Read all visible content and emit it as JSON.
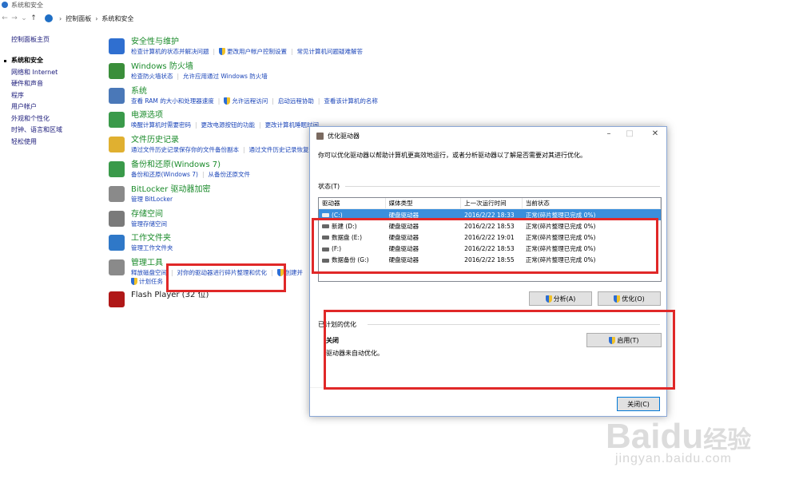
{
  "window": {
    "title": "系统和安全"
  },
  "address": {
    "crumbs": [
      "控制面板",
      "系统和安全"
    ]
  },
  "sidebar": {
    "home": "控制面板主页",
    "items": [
      "系统和安全",
      "网络和 Internet",
      "硬件和声音",
      "程序",
      "用户帐户",
      "外观和个性化",
      "时钟、语言和区域",
      "轻松使用"
    ]
  },
  "categories": [
    {
      "title": "安全性与维护",
      "links": [
        "检查计算机的状态并解决问题",
        "更改用户帐户控制设置",
        "常见计算机问题疑难解答"
      ],
      "icon": "flag-icon",
      "color": "#2f6fd0"
    },
    {
      "title": "Windows 防火墙",
      "links": [
        "检查防火墙状态",
        "允许应用通过 Windows 防火墙"
      ],
      "icon": "firewall-icon",
      "color": "#3a8e3a"
    },
    {
      "title": "系统",
      "links": [
        "查看 RAM 的大小和处理器速度",
        "允许远程访问",
        "启动远程协助",
        "查看该计算机的名称"
      ],
      "icon": "computer-icon",
      "color": "#4a78b8"
    },
    {
      "title": "电源选项",
      "links": [
        "唤醒计算机时需要密码",
        "更改电源按钮的功能",
        "更改计算机睡眠时间"
      ],
      "icon": "power-icon",
      "color": "#3a9a4a"
    },
    {
      "title": "文件历史记录",
      "links": [
        "通过文件历史记录保存你的文件备份副本",
        "通过文件历史记录恢复你的文件"
      ],
      "icon": "file-history-icon",
      "color": "#e0b030"
    },
    {
      "title": "备份和还原(Windows 7)",
      "links": [
        "备份和还原(Windows 7)",
        "从备份还原文件"
      ],
      "icon": "backup-icon",
      "color": "#3a9a4a"
    },
    {
      "title": "BitLocker 驱动器加密",
      "links": [
        "管理 BitLocker"
      ],
      "icon": "bitlocker-icon",
      "color": "#8a8a8a"
    },
    {
      "title": "存储空间",
      "links": [
        "管理存储空间"
      ],
      "icon": "storage-icon",
      "color": "#7a7a7a"
    },
    {
      "title": "工作文件夹",
      "links": [
        "管理工作文件夹"
      ],
      "icon": "work-folder-icon",
      "color": "#2f78c8"
    },
    {
      "title": "管理工具",
      "links": [
        "释放磁盘空间",
        "对你的驱动器进行碎片整理和优化",
        "创建并"
      ],
      "extra_link": "计划任务",
      "icon": "admin-tools-icon",
      "color": "#8a8a8a"
    },
    {
      "title": "Flash Player (32 位)",
      "links": [],
      "icon": "flash-icon",
      "color": "#b01818"
    }
  ],
  "dialog": {
    "title": "优化驱动器",
    "description": "你可以优化驱动器以帮助计算机更高效地运行，或者分析驱动器以了解是否需要对其进行优化。",
    "status_label": "状态(T)",
    "columns": [
      "驱动器",
      "媒体类型",
      "上一次运行时间",
      "当前状态"
    ],
    "drives": [
      {
        "name": "(C:)",
        "media": "硬盘驱动器",
        "last_run": "2016/2/22 18:33",
        "status": "正常(碎片整理已完成 0%)",
        "selected": true
      },
      {
        "name": "新建 (D:)",
        "media": "硬盘驱动器",
        "last_run": "2016/2/22 18:53",
        "status": "正常(碎片整理已完成 0%)",
        "selected": false
      },
      {
        "name": "数据盘 (E:)",
        "media": "硬盘驱动器",
        "last_run": "2016/2/22 19:01",
        "status": "正常(碎片整理已完成 0%)",
        "selected": false
      },
      {
        "name": "(F:)",
        "media": "硬盘驱动器",
        "last_run": "2016/2/22 18:53",
        "status": "正常(碎片整理已完成 0%)",
        "selected": false
      },
      {
        "name": "数据备份 (G:)",
        "media": "硬盘驱动器",
        "last_run": "2016/2/22 18:55",
        "status": "正常(碎片整理已完成 0%)",
        "selected": false
      }
    ],
    "analyze_button": "分析(A)",
    "optimize_button": "优化(O)",
    "scheduled_label": "已计划的优化",
    "schedule_state": "关闭",
    "schedule_desc": "驱动器未自动优化。",
    "enable_button": "启用(T)",
    "close_button": "关闭(C)"
  },
  "watermark": {
    "line1": "Bai",
    "line1b": "du",
    "line1c": "经验",
    "line2": "jingyan.baidu.com"
  }
}
